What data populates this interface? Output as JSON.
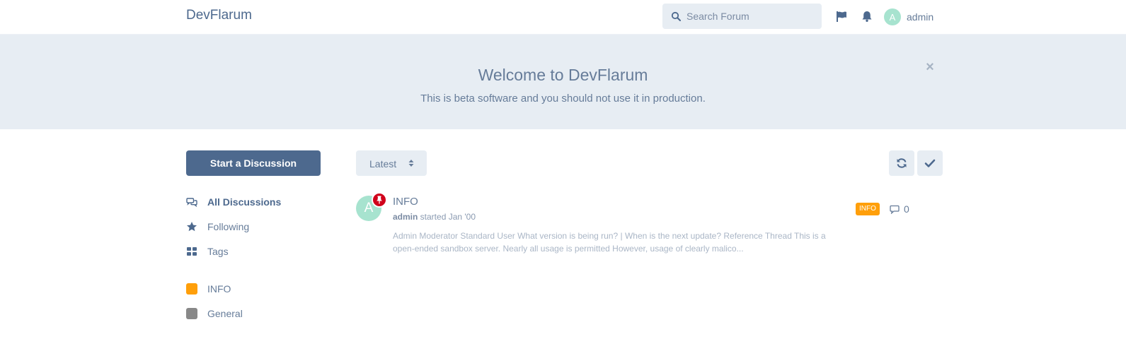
{
  "header": {
    "brand": "DevFlarum",
    "search_placeholder": "Search Forum",
    "icons": [
      "flag-icon",
      "bell-icon"
    ],
    "user": {
      "avatar_letter": "A",
      "name": "admin"
    }
  },
  "hero": {
    "title": "Welcome to DevFlarum",
    "description": "This is beta software and you should not use it in production.",
    "close_symbol": "×"
  },
  "sidebar": {
    "start_button": "Start a Discussion",
    "nav": [
      {
        "label": "All Discussions",
        "icon": "comments-icon",
        "active": true
      },
      {
        "label": "Following",
        "icon": "star-icon",
        "active": false
      },
      {
        "label": "Tags",
        "icon": "grid-icon",
        "active": false
      }
    ],
    "tags": [
      {
        "label": "INFO",
        "color": "#ff9f0a"
      },
      {
        "label": "General",
        "color": "#888888"
      }
    ]
  },
  "toolbar": {
    "sort_label": "Latest"
  },
  "discussions": [
    {
      "avatar_letter": "A",
      "title": "INFO",
      "author": "admin",
      "started_text": " started Jan '00",
      "excerpt": "Admin Moderator Standard User What version is being run? | When is the next update? Reference Thread This is a open-ended sandbox server. Nearly all usage is permitted However, usage of clearly malico...",
      "tag": "INFO",
      "tag_color": "#ff9f0a",
      "reply_count": "0",
      "pinned": true
    }
  ],
  "colors": {
    "primary": "#4d698e",
    "muted": "#667c99",
    "hero_bg": "#e7edf3",
    "pin": "#d0021b",
    "avatar": "#a7e3cf"
  }
}
